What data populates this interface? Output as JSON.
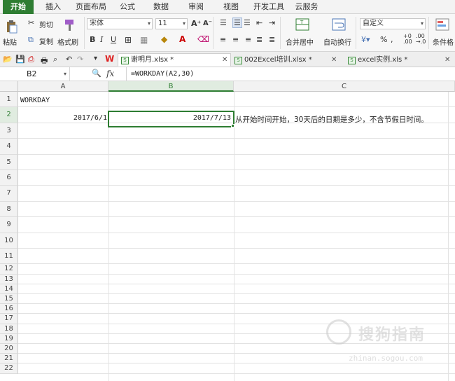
{
  "menu": {
    "tabs": [
      "开始",
      "插入",
      "页面布局",
      "公式",
      "数据",
      "审阅",
      "视图",
      "开发工具",
      "云服务"
    ],
    "active_index": 0
  },
  "ribbon": {
    "paste_label": "粘贴",
    "cut_label": "剪切",
    "copy_label": "复制",
    "format_painter_label": "格式刷",
    "font_name": "宋体",
    "font_size": "11",
    "bold": "B",
    "italic": "I",
    "underline": "U",
    "merge_center_label": "合并居中",
    "auto_wrap_label": "自动换行",
    "number_format": "自定义",
    "percent": "%",
    "conditional_format_label": "条件格"
  },
  "doc_tabs": [
    {
      "name": "谢明月.xlsx *",
      "active": true
    },
    {
      "name": "002Excel培训.xlsx *",
      "active": false
    },
    {
      "name": "excel实例.xls *",
      "active": false
    }
  ],
  "formula_bar": {
    "cell_ref": "B2",
    "fx_label": "fx",
    "formula": "=WORKDAY(A2,30)"
  },
  "sheet": {
    "columns": [
      "A",
      "B",
      "C"
    ],
    "selected_column": "B",
    "rows": [
      "1",
      "2",
      "3",
      "4",
      "5",
      "6",
      "7",
      "8",
      "9",
      "10",
      "11",
      "12",
      "13",
      "14",
      "15",
      "16",
      "17",
      "18",
      "19",
      "20",
      "21",
      "22"
    ],
    "cells": {
      "A1": "WORKDAY",
      "A2": "2017/6/1",
      "B2": "2017/7/13",
      "C2": "从开始时间开始，30天后的日期是多少，不含节假日时间。"
    }
  },
  "watermark": {
    "text": "搜狗指南",
    "sub": "zhinan.sogou.com"
  },
  "colors": {
    "accent": "#2e7d32",
    "header_bg": "#f2f2f2"
  }
}
